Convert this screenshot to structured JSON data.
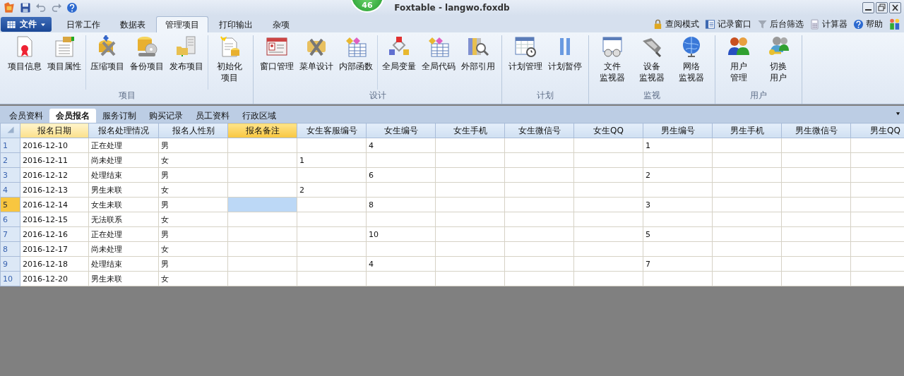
{
  "window": {
    "title": "Foxtable - langwo.foxdb",
    "badge": "46"
  },
  "ribbon_tabs": [
    {
      "label": "文件",
      "kind": "file"
    },
    {
      "label": "日常工作",
      "kind": "tab",
      "selected": false
    },
    {
      "label": "数据表",
      "kind": "tab",
      "selected": false
    },
    {
      "label": "管理项目",
      "kind": "tab",
      "selected": true
    },
    {
      "label": "打印输出",
      "kind": "tab",
      "selected": false
    },
    {
      "label": "杂项",
      "kind": "tab",
      "selected": false
    }
  ],
  "toolbar_right": [
    {
      "label": "查阅模式"
    },
    {
      "label": "记录窗口"
    },
    {
      "label": "后台筛选"
    },
    {
      "label": "计算器"
    },
    {
      "label": "帮助"
    }
  ],
  "ribbon_groups": [
    {
      "label": "项目",
      "sections": [
        [
          {
            "lines": [
              "项目信息"
            ]
          },
          {
            "lines": [
              "项目属性"
            ]
          }
        ],
        [
          {
            "lines": [
              "压缩项目"
            ]
          },
          {
            "lines": [
              "备份项目"
            ]
          },
          {
            "lines": [
              "发布项目"
            ]
          }
        ],
        [
          {
            "lines": [
              "初始化",
              "项目"
            ]
          }
        ]
      ]
    },
    {
      "label": "设计",
      "sections": [
        [
          {
            "lines": [
              "窗口管理"
            ]
          },
          {
            "lines": [
              "菜单设计"
            ]
          },
          {
            "lines": [
              "内部函数"
            ]
          }
        ],
        [
          {
            "lines": [
              "全局变量"
            ]
          },
          {
            "lines": [
              "全局代码"
            ]
          },
          {
            "lines": [
              "外部引用"
            ]
          }
        ]
      ]
    },
    {
      "label": "计划",
      "sections": [
        [
          {
            "lines": [
              "计划管理"
            ]
          },
          {
            "lines": [
              "计划暂停"
            ]
          }
        ]
      ]
    },
    {
      "label": "监视",
      "sections": [
        [
          {
            "lines": [
              "文件",
              "监视器"
            ]
          },
          {
            "lines": [
              "设备",
              "监视器"
            ]
          },
          {
            "lines": [
              "网络",
              "监视器"
            ]
          }
        ]
      ]
    },
    {
      "label": "用户",
      "sections": [
        [
          {
            "lines": [
              "用户",
              "管理"
            ]
          },
          {
            "lines": [
              "切换",
              "用户"
            ]
          }
        ]
      ]
    }
  ],
  "sheet_tabs": [
    {
      "label": "会员资料",
      "selected": false
    },
    {
      "label": "会员报名",
      "selected": true
    },
    {
      "label": "服务订制",
      "selected": false
    },
    {
      "label": "购买记录",
      "selected": false
    },
    {
      "label": "员工资料",
      "selected": false
    },
    {
      "label": "行政区域",
      "selected": false
    }
  ],
  "table": {
    "columns": [
      {
        "label": "报名日期",
        "sorted": true,
        "selected": false
      },
      {
        "label": "报名处理情况",
        "sorted": false,
        "selected": false
      },
      {
        "label": "报名人性别",
        "sorted": false,
        "selected": false
      },
      {
        "label": "报名备注",
        "sorted": false,
        "selected": true
      },
      {
        "label": "女生客服编号",
        "sorted": false,
        "selected": false
      },
      {
        "label": "女生编号",
        "sorted": false,
        "selected": false
      },
      {
        "label": "女生手机",
        "sorted": false,
        "selected": false
      },
      {
        "label": "女生微信号",
        "sorted": false,
        "selected": false
      },
      {
        "label": "女生QQ",
        "sorted": false,
        "selected": false
      },
      {
        "label": "男生编号",
        "sorted": false,
        "selected": false
      },
      {
        "label": "男生手机",
        "sorted": false,
        "selected": false
      },
      {
        "label": "男生微信号",
        "sorted": false,
        "selected": false
      },
      {
        "label": "男生QQ",
        "sorted": false,
        "selected": false
      }
    ],
    "rows": [
      {
        "number": "1",
        "selected": false,
        "cells": [
          "2016-12-10",
          "正在处理",
          "男",
          "",
          "",
          "4",
          "",
          "",
          "",
          "1",
          "",
          "",
          ""
        ]
      },
      {
        "number": "2",
        "selected": false,
        "cells": [
          "2016-12-11",
          "尚未处理",
          "女",
          "",
          "1",
          "",
          "",
          "",
          "",
          "",
          "",
          "",
          ""
        ]
      },
      {
        "number": "3",
        "selected": false,
        "cells": [
          "2016-12-12",
          "处理结束",
          "男",
          "",
          "",
          "6",
          "",
          "",
          "",
          "2",
          "",
          "",
          ""
        ]
      },
      {
        "number": "4",
        "selected": false,
        "cells": [
          "2016-12-13",
          "男生未联",
          "女",
          "",
          "2",
          "",
          "",
          "",
          "",
          "",
          "",
          "",
          ""
        ]
      },
      {
        "number": "5",
        "selected": true,
        "cells": [
          "2016-12-14",
          "女生未联",
          "男",
          "",
          "",
          "8",
          "",
          "",
          "",
          "3",
          "",
          "",
          ""
        ]
      },
      {
        "number": "6",
        "selected": false,
        "cells": [
          "2016-12-15",
          "无法联系",
          "女",
          "",
          "",
          "",
          "",
          "",
          "",
          "",
          "",
          "",
          ""
        ]
      },
      {
        "number": "7",
        "selected": false,
        "cells": [
          "2016-12-16",
          "正在处理",
          "男",
          "",
          "",
          "10",
          "",
          "",
          "",
          "5",
          "",
          "",
          ""
        ]
      },
      {
        "number": "8",
        "selected": false,
        "cells": [
          "2016-12-17",
          "尚未处理",
          "女",
          "",
          "",
          "",
          "",
          "",
          "",
          "",
          "",
          "",
          ""
        ]
      },
      {
        "number": "9",
        "selected": false,
        "cells": [
          "2016-12-18",
          "处理结束",
          "男",
          "",
          "",
          "4",
          "",
          "",
          "",
          "7",
          "",
          "",
          ""
        ]
      },
      {
        "number": "10",
        "selected": false,
        "cells": [
          "2016-12-20",
          "男生未联",
          "女",
          "",
          "",
          "",
          "",
          "",
          "",
          "",
          "",
          "",
          ""
        ]
      }
    ]
  }
}
